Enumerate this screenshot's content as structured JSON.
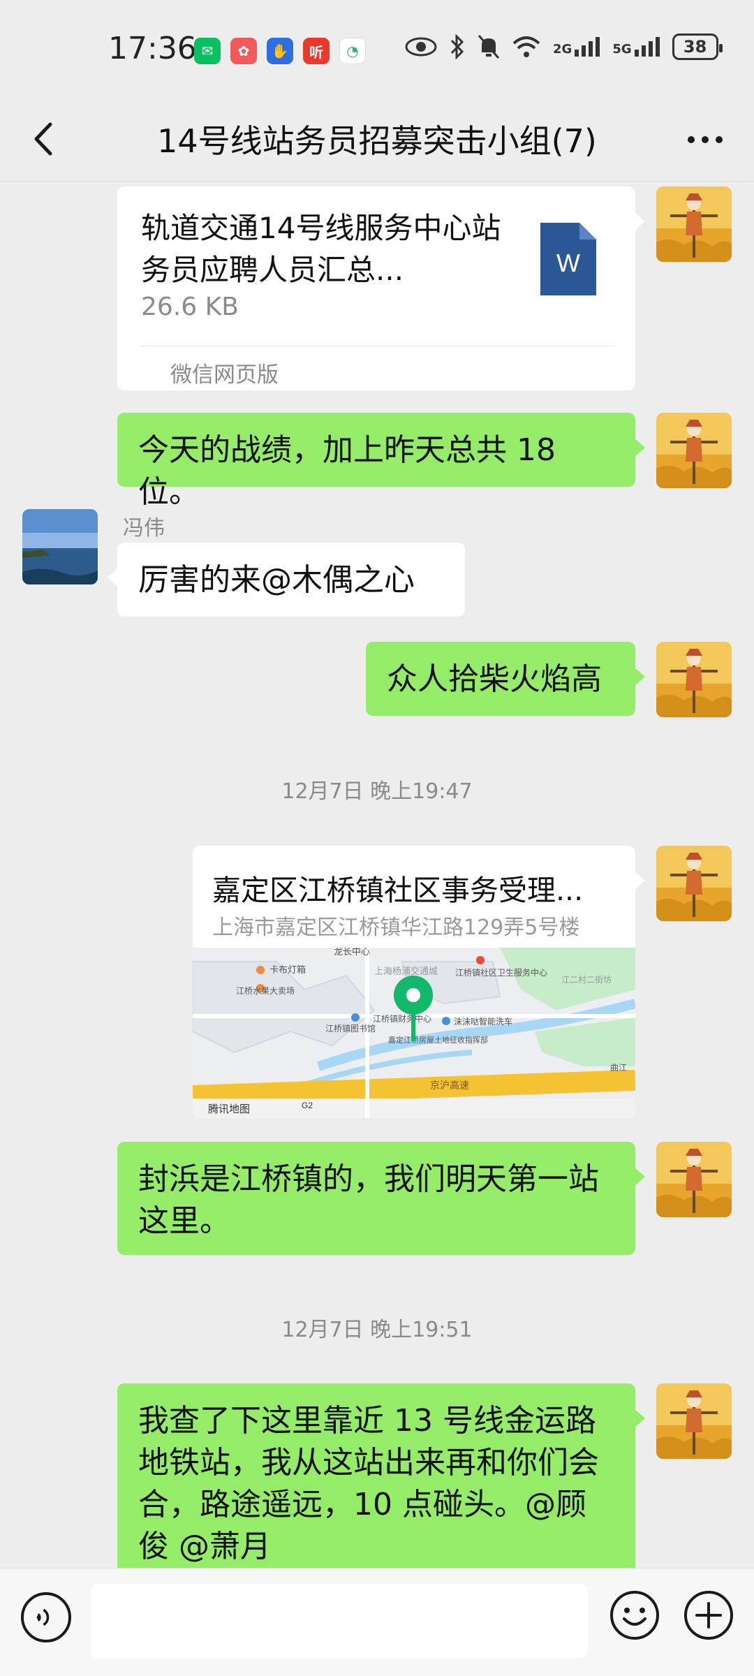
{
  "status_bar": {
    "time": "17:36",
    "app_icons": [
      {
        "name": "wechat-notif-icon",
        "glyph": "✉",
        "color": "#07c160"
      },
      {
        "name": "app-notif-icon",
        "glyph": "✿",
        "color": "#f05a5a"
      },
      {
        "name": "hand-notif-icon",
        "glyph": "✋",
        "color": "#2b6fe0"
      },
      {
        "name": "ting-notif-icon",
        "glyph": "听",
        "color": "#e8392b"
      },
      {
        "name": "chat-notif-icon",
        "glyph": "◔",
        "color": "#ffffff"
      }
    ],
    "network_2g": "2G",
    "network_5g": "5G",
    "battery": "38"
  },
  "header": {
    "title": "14号线站务员招募突击小组(7)"
  },
  "messages": {
    "file": {
      "name": "轨道交通14号线服务中心站务员应聘人员汇总...",
      "size": "26.6 KB",
      "icon_letter": "W",
      "source": "微信网页版"
    },
    "msg1": "今天的战绩，加上昨天总共 18 位。",
    "sender_name": "冯伟",
    "msg2": "厉害的来@木偶之心",
    "msg3": "众人拾柴火焰高",
    "time1": "12月7日 晚上19:47",
    "location": {
      "title": "嘉定区江桥镇社区事务受理...",
      "address": "上海市嘉定区江桥镇华江路129弄5号楼",
      "map_labels": [
        "龙长中心",
        "卡布灯箱",
        "江桥水果大卖场",
        "上海杨浦交通城",
        "江桥镇社区卫生服务中心",
        "江二村二街坊",
        "江桥镇图书馆",
        "江桥镇财务中心",
        "沫沫哒智能洗车",
        "嘉定江桥房屋土地征收指挥部",
        "京沪高速",
        "腾讯地图",
        "G2",
        "曲江"
      ]
    },
    "msg4": "封浜是江桥镇的，我们明天第一站这里。",
    "time2": "12月7日 晚上19:51",
    "msg5": "我查了下这里靠近 13 号线金运路地铁站，我从这站出来再和你们会合，路途遥远，10 点碰头。@顾俊 @萧月"
  },
  "colors": {
    "bubble_green": "#95ec69",
    "background": "#ededed",
    "word_blue": "#2b5797"
  }
}
